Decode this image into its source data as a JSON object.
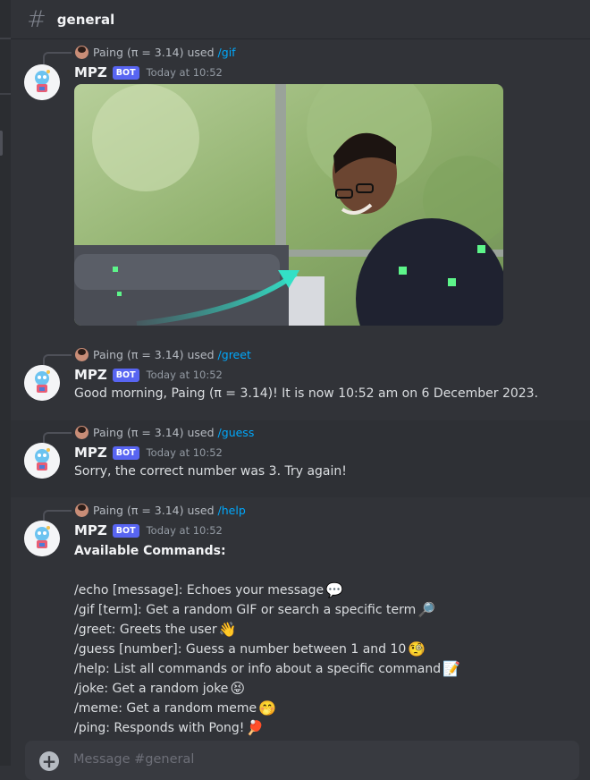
{
  "channel": {
    "name": "general"
  },
  "messages": [
    {
      "reply": {
        "user": "Paing (π = 3.14)",
        "used": "used",
        "command": "/gif"
      },
      "author": "MPZ",
      "badge": "BOT",
      "time": "Today at 10:52",
      "attachment": "gif"
    },
    {
      "reply": {
        "user": "Paing (π = 3.14)",
        "used": "used",
        "command": "/greet"
      },
      "author": "MPZ",
      "badge": "BOT",
      "time": "Today at 10:52",
      "text": "Good morning, Paing (π = 3.14)! It is now 10:52 am on 6 December 2023."
    },
    {
      "reply": {
        "user": "Paing (π = 3.14)",
        "used": "used",
        "command": "/guess"
      },
      "author": "MPZ",
      "badge": "BOT",
      "time": "Today at 10:52",
      "text": "Sorry, the correct number was 3. Try again!"
    },
    {
      "reply": {
        "user": "Paing (π = 3.14)",
        "used": "used",
        "command": "/help"
      },
      "author": "MPZ",
      "badge": "BOT",
      "time": "Today at 10:52",
      "heading": "Available Commands:",
      "commands": [
        {
          "text": "/echo [message]: Echoes your message",
          "emoji": "💬",
          "icon": "speech-balloon"
        },
        {
          "text": "/gif [term]: Get a random GIF or search a specific term",
          "emoji": "🔎",
          "icon": "magnifier"
        },
        {
          "text": "/greet: Greets the user",
          "emoji": "👋",
          "icon": "waving-hand"
        },
        {
          "text": "/guess [number]: Guess a number between 1 and 10",
          "emoji": "🧐",
          "icon": "monocle-face"
        },
        {
          "text": "/help: List all commands or info about a specific command",
          "emoji": "📝",
          "icon": "memo"
        },
        {
          "text": "/joke: Get a random joke",
          "emoji": "😝",
          "icon": "tongue-face"
        },
        {
          "text": "/meme: Get a random meme",
          "emoji": "🤭",
          "icon": "hand-over-mouth"
        },
        {
          "text": "/ping: Responds with Pong!",
          "emoji": "🏓",
          "icon": "ping-pong"
        }
      ]
    }
  ],
  "composer": {
    "placeholder": "Message #general"
  },
  "colors": {
    "background": "#313338",
    "bot_badge": "#5865f2",
    "command_link": "#00a8fc"
  }
}
